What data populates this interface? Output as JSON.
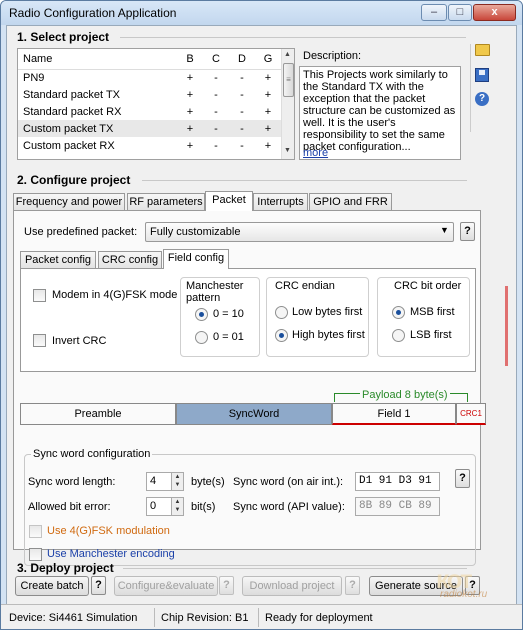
{
  "window": {
    "title": "Radio Configuration Application",
    "minimize": "–",
    "maximize": "□",
    "close": "x"
  },
  "section1": {
    "title": "1. Select project",
    "columns": [
      "Name",
      "B",
      "C",
      "D",
      "G"
    ],
    "rows": [
      {
        "name": "PN9",
        "b": "+",
        "c": "-",
        "d": "-",
        "g": "+"
      },
      {
        "name": "Standard packet TX",
        "b": "+",
        "c": "-",
        "d": "-",
        "g": "+"
      },
      {
        "name": "Standard packet RX",
        "b": "+",
        "c": "-",
        "d": "-",
        "g": "+"
      },
      {
        "name": "Custom packet TX",
        "b": "+",
        "c": "-",
        "d": "-",
        "g": "+"
      },
      {
        "name": "Custom packet RX",
        "b": "+",
        "c": "-",
        "d": "-",
        "g": "+"
      }
    ],
    "description_label": "Description:",
    "description": "This Projects work similarly to the Standard TX with the exception that the packet structure can be customized as well. It is the user's responsibility to set the same packet configuration...",
    "more_link": "more"
  },
  "section2": {
    "title": "2. Configure project",
    "tabs": [
      "Frequency and power",
      "RF parameters",
      "Packet",
      "Interrupts",
      "GPIO and FRR"
    ],
    "predefined_label": "Use predefined packet:",
    "predefined_value": "Fully customizable",
    "help": "?",
    "subtabs": [
      "Packet config",
      "CRC config",
      "Field config"
    ],
    "modem_label": "Modem in 4(G)FSK mode",
    "invert_crc_label": "Invert CRC",
    "manchester_title": "Manchester pattern",
    "manchester_opts": [
      "0 = 10",
      "0 = 01"
    ],
    "crc_endian_title": "CRC endian",
    "crc_endian_opts": [
      "Low bytes first",
      "High bytes first"
    ],
    "crc_bitorder_title": "CRC bit order",
    "crc_bitorder_opts": [
      "MSB first",
      "LSB first"
    ],
    "payload_label": "Payload 8 byte(s)",
    "bar": {
      "preamble": "Preamble",
      "syncword": "SyncWord",
      "field1": "Field 1",
      "crc": "CRC1"
    },
    "sync": {
      "title": "Sync word configuration",
      "length_label": "Sync word length:",
      "length_value": "4",
      "length_unit": "byte(s)",
      "error_label": "Allowed bit error:",
      "error_value": "0",
      "error_unit": "bit(s)",
      "onair_label": "Sync word (on air int.):",
      "onair_value": "D1 91 D3 91",
      "api_label": "Sync word (API value):",
      "api_value": "8B 89 CB 89",
      "fsk_label": "Use 4(G)FSK modulation",
      "manchester_label": "Use Manchester encoding"
    }
  },
  "section3": {
    "title": "3. Deploy project",
    "create_batch": "Create batch",
    "configure": "Configure&evaluate",
    "download": "Download project",
    "generate": "Generate source"
  },
  "status": {
    "device": "Device: Si4461  Simulation",
    "revision": "Chip Revision: B1",
    "state": "Ready for deployment"
  },
  "watermark": "radiokot.ru",
  "colors": {
    "syncword": "#8ea9c9",
    "payload_green": "#2a8a2a",
    "crc_red": "#cc0000",
    "orange_label": "#d06a10",
    "blue_label": "#1a3fa8"
  }
}
